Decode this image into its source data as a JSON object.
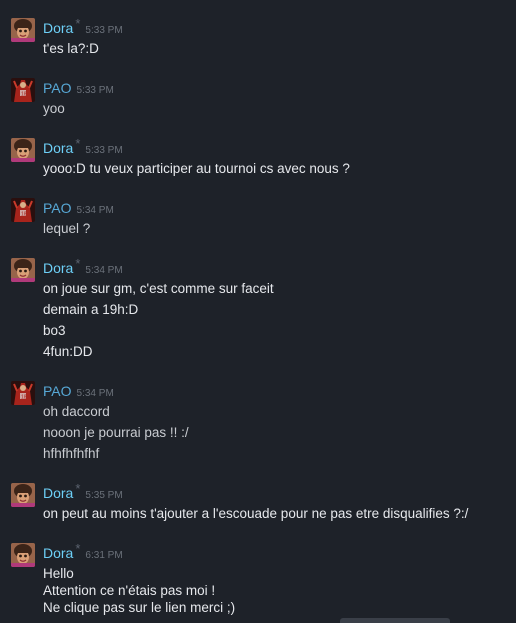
{
  "messages": [
    {
      "user": "Dora",
      "time": "5:33 PM",
      "starred": true,
      "lines": [
        "t'es la?:D"
      ]
    },
    {
      "user": "PAO",
      "time": "5:33 PM",
      "starred": false,
      "lines": [
        "yoo"
      ]
    },
    {
      "user": "Dora",
      "time": "5:33 PM",
      "starred": true,
      "lines": [
        "yooo:D tu veux participer au tournoi cs avec nous ?"
      ]
    },
    {
      "user": "PAO",
      "time": "5:34 PM",
      "starred": false,
      "lines": [
        "lequel ?"
      ]
    },
    {
      "user": "Dora",
      "time": "5:34 PM",
      "starred": true,
      "lines": [
        "on joue sur gm, c'est comme sur faceit",
        "demain a 19h:D",
        "bo3",
        "4fun:DD"
      ]
    },
    {
      "user": "PAO",
      "time": "5:34 PM",
      "starred": false,
      "lines": [
        "oh daccord",
        "nooon je pourrai pas !! :/",
        "hfhfhfhfhf"
      ]
    },
    {
      "user": "Dora",
      "time": "5:35 PM",
      "starred": true,
      "lines": [
        "on peut au moins t'ajouter a l'escouade pour ne pas etre disqualifies ?:/"
      ]
    },
    {
      "user": "Dora",
      "time": "6:31 PM",
      "starred": true,
      "lines": [
        "Hello",
        "Attention ce n'étais pas moi !",
        "Ne clique pas sur le lien merci ;)"
      ]
    }
  ],
  "icons": {
    "dora_avatar": "dora-avatar-icon",
    "pao_avatar": "pao-avatar-icon",
    "star": "star-icon"
  },
  "colors": {
    "background": "#1e2229",
    "dora_name": "#6dcff6",
    "pao_name": "#57a8d6",
    "timestamp": "#6b717a",
    "text": "#e6e8ec"
  }
}
